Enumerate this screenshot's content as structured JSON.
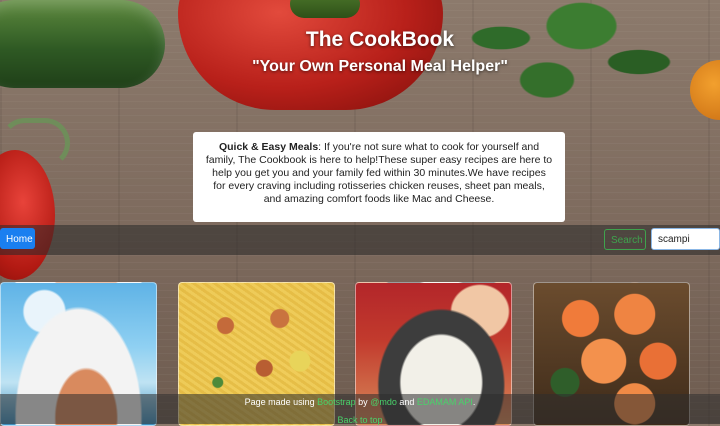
{
  "header": {
    "title": "The CookBook",
    "subtitle": "\"Your Own Personal Meal Helper\""
  },
  "intro": {
    "bold": "Quick & Easy Meals",
    "text": ": If you're not sure what to cook for yourself and family, The Cookbook is here to help!These super easy recipes are here to help you get you and your family fed within 30 minutes.We have recipes for every craving including rotisseries chicken reuses, sheet pan meals, and amazing comfort foods like Mac and Cheese."
  },
  "navbar": {
    "home_label": "Home",
    "search_label": "Search",
    "search_value": "scampi"
  },
  "cards": [
    {
      "name": "recipe-card-1"
    },
    {
      "name": "recipe-card-2"
    },
    {
      "name": "recipe-card-3"
    },
    {
      "name": "recipe-card-4"
    }
  ],
  "footer": {
    "prefix": "Page made using ",
    "bootstrap": "Bootstrap",
    "by": " by ",
    "mdo": "@mdo",
    "and": " and ",
    "edamam": "EDAMAM API",
    "period": ".",
    "back_to_top": "Back to top"
  }
}
